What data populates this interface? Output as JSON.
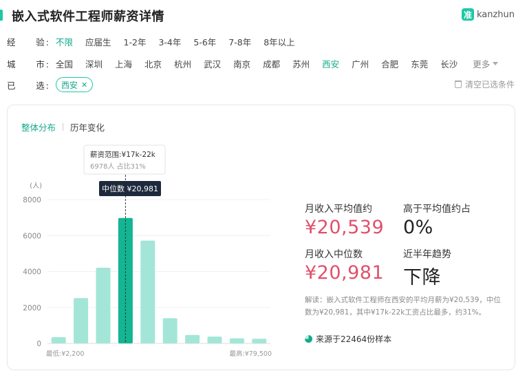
{
  "header": {
    "title": "嵌入式软件工程师薪资详情",
    "brand_logo": "准",
    "brand_name": "kanzhun"
  },
  "filters": {
    "experience": {
      "label_a": "经",
      "label_b": "验",
      "options": [
        "不限",
        "应届生",
        "1-2年",
        "3-4年",
        "5-6年",
        "7-8年",
        "8年以上"
      ],
      "selected": "不限"
    },
    "city": {
      "label_a": "城",
      "label_b": "市",
      "options": [
        "全国",
        "深圳",
        "上海",
        "北京",
        "杭州",
        "武汉",
        "南京",
        "成都",
        "苏州",
        "西安",
        "广州",
        "合肥",
        "东莞",
        "长沙"
      ],
      "selected": "西安",
      "more_label": "更多"
    },
    "selected": {
      "label_a": "已",
      "label_b": "选",
      "chips": [
        "西安"
      ],
      "clear_label": "清空已选条件"
    }
  },
  "tabs": [
    "整体分布",
    "历年变化"
  ],
  "active_tab": "整体分布",
  "chart_data": {
    "type": "bar",
    "ylabel": "(人)",
    "yticks": [
      "8000",
      "6000",
      "4000",
      "2000",
      "0"
    ],
    "ylim": [
      0,
      8000
    ],
    "values": [
      350,
      2520,
      4210,
      6978,
      5720,
      1400,
      470,
      380,
      280,
      260
    ],
    "highlight_index": 3,
    "x_min_label": "最低:¥2,200",
    "x_max_label": "最高:¥79,500",
    "median_label": "中位数 ¥20,981",
    "tooltip": {
      "title": "薪资范围:¥17k-22k",
      "detail": "6978人 占比31%"
    },
    "bar_color": "#a3e6d8",
    "highlight_color": "#13b592"
  },
  "stats": {
    "avg_label": "月收入平均值约",
    "avg_value": "¥20,539",
    "above_label": "高于平均值约占",
    "above_value": "0%",
    "median_label": "月收入中位数",
    "median_value": "¥20,981",
    "trend_label": "近半年趋势",
    "trend_value": "下降"
  },
  "explanation": "解读：嵌入式软件工程师在西安的平均月薪为¥20,539，中位数为¥20,981，其中¥17k-22k工资占比最多，约31%。",
  "source": "来源于22464份样本"
}
